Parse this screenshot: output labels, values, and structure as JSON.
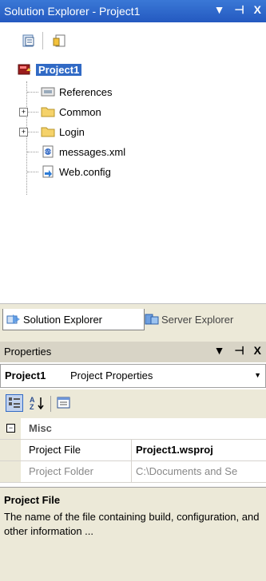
{
  "solution_explorer": {
    "title": "Solution Explorer - Project1",
    "buttons": {
      "dropdown": "▼",
      "pin": "⊣",
      "close": "X"
    },
    "tree": [
      {
        "label": "Project1"
      },
      {
        "label": "References"
      },
      {
        "label": "Common"
      },
      {
        "label": "Login"
      },
      {
        "label": "messages.xml"
      },
      {
        "label": "Web.config"
      }
    ]
  },
  "tabs": {
    "solution_explorer": "Solution Explorer",
    "server_explorer": "Server Explorer"
  },
  "properties": {
    "title": "Properties",
    "buttons": {
      "dropdown": "▼",
      "pin": "⊣",
      "close": "X"
    },
    "object_name": "Project1",
    "object_type": "Project Properties",
    "category": "Misc",
    "rows": [
      {
        "name": "Project File",
        "value": "Project1.wsproj"
      },
      {
        "name": "Project Folder",
        "value": "C:\\Documents and Se"
      }
    ],
    "description_title": "Project File",
    "description_text": "The name of the file containing build, configuration, and other information ..."
  },
  "colors": {
    "title_active": "#2c63c9",
    "selection": "#316ac5",
    "panel_bg": "#ece9d8"
  }
}
